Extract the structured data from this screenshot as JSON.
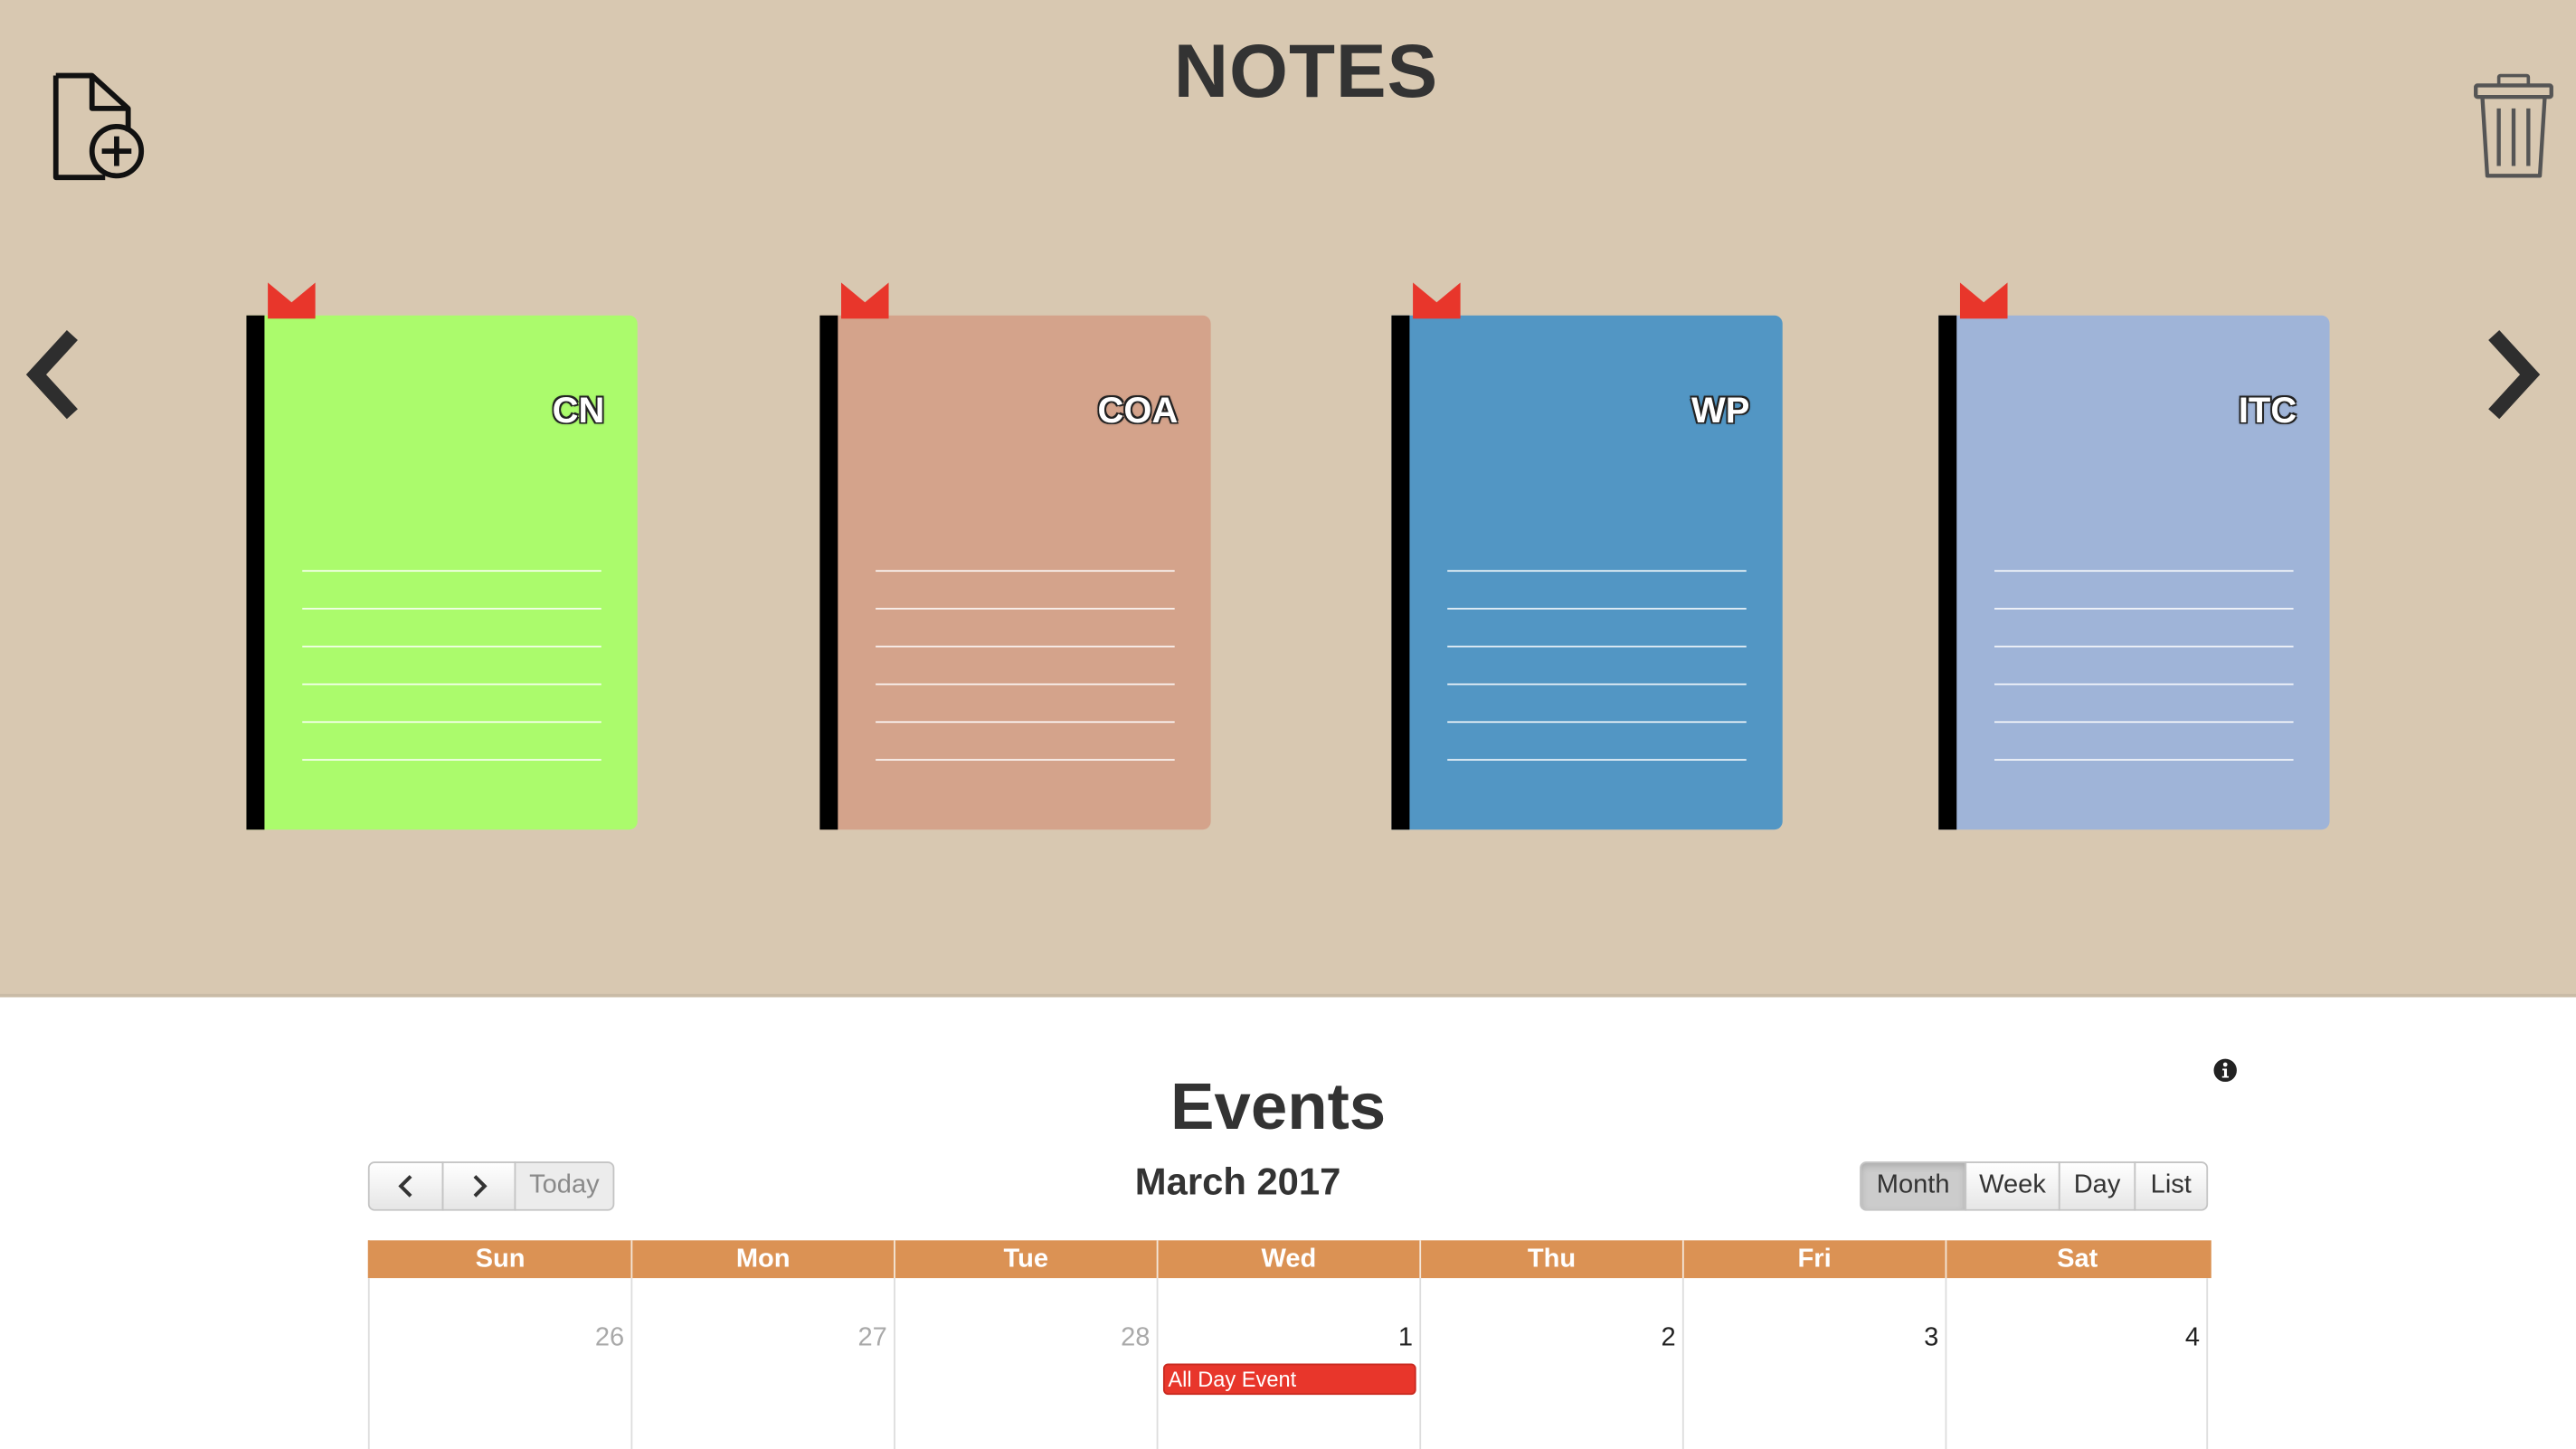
{
  "notes": {
    "title": "NOTES",
    "new_note_icon": "file-add-icon",
    "trash_icon": "trash-icon",
    "prev_icon": "chevron-left-icon",
    "next_icon": "chevron-right-icon",
    "notebooks": [
      {
        "label": "CN",
        "color": "#abfb6c"
      },
      {
        "label": "COA",
        "color": "#d4a38b"
      },
      {
        "label": "WP",
        "color": "#5296c4"
      },
      {
        "label": "ITC",
        "color": "#9fb4d8"
      }
    ],
    "ribbon_color": "#e8362b"
  },
  "events": {
    "title": "Events",
    "info_icon": "info-icon",
    "toolbar": {
      "prev_icon": "chevron-left-icon",
      "next_icon": "chevron-right-icon",
      "today_label": "Today",
      "month_title": "March 2017",
      "views": [
        "Month",
        "Week",
        "Day",
        "List"
      ],
      "active_view": "Month"
    },
    "weekdays": [
      "Sun",
      "Mon",
      "Tue",
      "Wed",
      "Thu",
      "Fri",
      "Sat"
    ],
    "week_rows": [
      [
        {
          "day": "26",
          "other_month": true
        },
        {
          "day": "27",
          "other_month": true
        },
        {
          "day": "28",
          "other_month": true
        },
        {
          "day": "1",
          "other_month": false,
          "event": "All Day Event"
        },
        {
          "day": "2",
          "other_month": false
        },
        {
          "day": "3",
          "other_month": false
        },
        {
          "day": "4",
          "other_month": false
        }
      ]
    ],
    "header_color": "#db9254",
    "event_color": "#e8362b"
  }
}
